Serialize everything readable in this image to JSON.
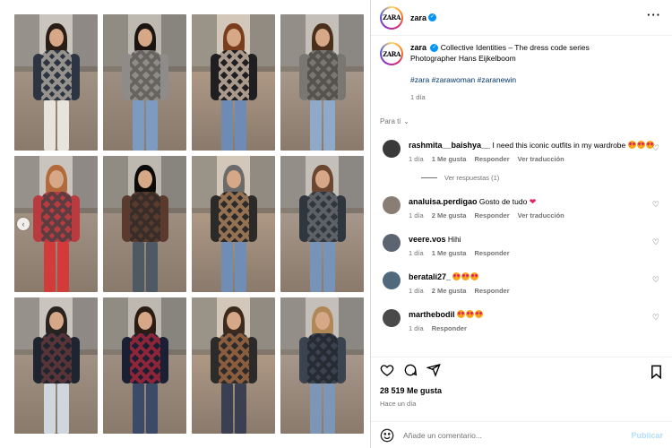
{
  "post": {
    "author": "zara",
    "avatar_label": "ZARA",
    "caption_title": "Collective Identities – The dress code series",
    "caption_line2": "Photographer Hans Eijkelboom",
    "hashtags": "#zara #zarawoman #zaranewin",
    "caption_time": "1 día",
    "sort_label": "Para ti",
    "likes": "28 519 Me gusta",
    "posted": "Hace un día"
  },
  "comments": [
    {
      "user": "rashmita__baishya__",
      "text": "I need this iconic outfits in my wardrobe",
      "emoji_count": 3,
      "time": "1 día",
      "likes": "1 Me gusta",
      "reply": "Responder",
      "translate": "Ver traducción",
      "avatar_color": "#3a3a3a",
      "replies_label": "Ver respuestas (1)"
    },
    {
      "user": "analuisa.perdigao",
      "text": "Gosto de tudo",
      "red_heart": true,
      "time": "1 día",
      "likes": "2 Me gusta",
      "reply": "Responder",
      "translate": "Ver traducción",
      "avatar_color": "#8a7e74"
    },
    {
      "user": "veere.vos",
      "text": "Hihi",
      "time": "1 día",
      "likes": "1 Me gusta",
      "reply": "Responder",
      "avatar_color": "#5b6470"
    },
    {
      "user": "beratali27_",
      "text": "",
      "emoji_count": 3,
      "time": "1 día",
      "likes": "2 Me gusta",
      "reply": "Responder",
      "avatar_color": "#506a7d"
    },
    {
      "user": "marthebodil",
      "text": "",
      "emoji_count": 3,
      "time": "1 día",
      "reply": "Responder",
      "avatar_color": "#4a4a4a"
    }
  ],
  "composer": {
    "placeholder": "Añade un comentario...",
    "publish": "Publicar"
  },
  "icons": {
    "like": "heart-outline-icon",
    "comment": "comment-bubble-icon",
    "share": "paper-plane-icon",
    "save": "bookmark-icon",
    "more": "more-dots-icon",
    "prev": "chevron-left-icon",
    "verified": "verified-badge-icon",
    "emoji": "smile-emoji-icon"
  },
  "photos": [
    {
      "sweater": "#2d3542",
      "argyle": "#b9b2a8",
      "pants": "#e7e4de",
      "hair": "#2a1d15"
    },
    {
      "sweater": "#8e8b88",
      "argyle": "#5a5752",
      "pants": "#7d9bc0",
      "hair": "#1b1411"
    },
    {
      "sweater": "#1f1f22",
      "argyle": "#d7c3ae",
      "pants": "#6d8bb4",
      "hair": "#7a3e1e"
    },
    {
      "sweater": "#7a7773",
      "argyle": "#4a4744",
      "pants": "#8fa9c9",
      "hair": "#4b2f1d"
    },
    {
      "sweater": "#b93a3f",
      "argyle": "#3d3f45",
      "pants": "#d33b3b",
      "hair": "#b26a3a"
    },
    {
      "sweater": "#5a3a2c",
      "argyle": "#2f2a28",
      "pants": "#4e5963",
      "hair": "#0d0b0a"
    },
    {
      "sweater": "#2b2a28",
      "argyle": "#b98a60",
      "pants": "#6f8db5",
      "hair": "#6b6b6b"
    },
    {
      "sweater": "#30363e",
      "argyle": "#6d6f73",
      "pants": "#7893b8",
      "hair": "#6b4630"
    },
    {
      "sweater": "#1e2430",
      "argyle": "#6b3a3a",
      "pants": "#cfd6de",
      "hair": "#2a2420"
    },
    {
      "sweater": "#1a1f33",
      "argyle": "#b2283a",
      "pants": "#3b4a66",
      "hair": "#2b1c13"
    },
    {
      "sweater": "#2c2b2a",
      "argyle": "#a86f45",
      "pants": "#3b3f52",
      "hair": "#3c2a1f"
    },
    {
      "sweater": "#3c4350",
      "argyle": "#1f232b",
      "pants": "#7d96b6",
      "hair": "#b08858"
    }
  ]
}
